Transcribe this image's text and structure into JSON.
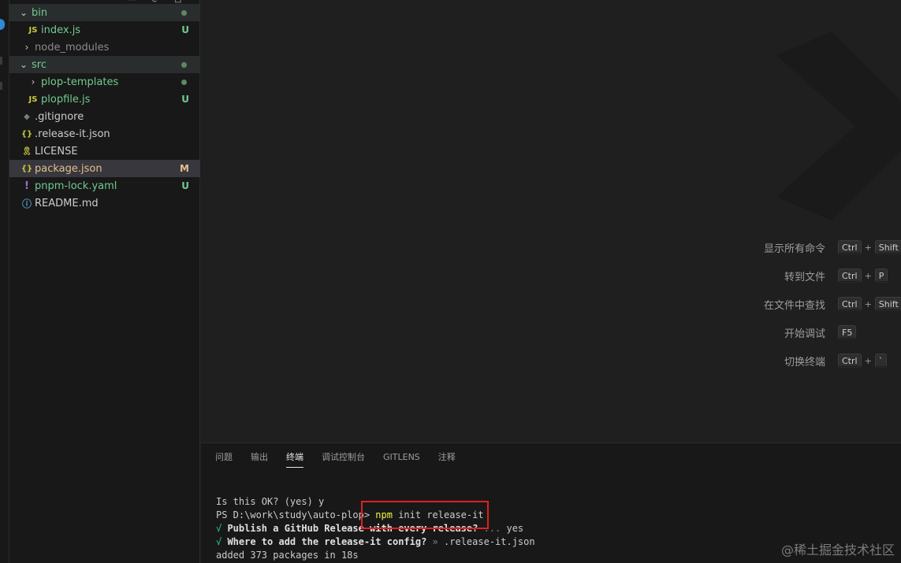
{
  "explorer": {
    "items": [
      {
        "name": "bin",
        "type": "folder",
        "open": true,
        "status": "dot"
      },
      {
        "name": "index.js",
        "type": "js",
        "icon": "JS",
        "status": "U"
      },
      {
        "name": "node_modules",
        "type": "folder",
        "open": false,
        "status": ""
      },
      {
        "name": "src",
        "type": "folder",
        "open": true,
        "status": "dot"
      },
      {
        "name": "plop-templates",
        "type": "folder",
        "open": false,
        "status": "dot"
      },
      {
        "name": "plopfile.js",
        "type": "js",
        "icon": "JS",
        "status": "U"
      },
      {
        "name": ".gitignore",
        "type": "git",
        "icon": "◆",
        "status": ""
      },
      {
        "name": ".release-it.json",
        "type": "json",
        "icon": "{}",
        "status": ""
      },
      {
        "name": "LICENSE",
        "type": "license",
        "icon": "🎗",
        "status": ""
      },
      {
        "name": "package.json",
        "type": "json",
        "icon": "{}",
        "status": "M"
      },
      {
        "name": "pnpm-lock.yaml",
        "type": "yaml",
        "icon": "!",
        "status": "U"
      },
      {
        "name": "README.md",
        "type": "info",
        "icon": "ⓘ",
        "status": ""
      }
    ]
  },
  "shortcuts": [
    {
      "label": "显示所有命令",
      "keys": [
        "Ctrl",
        "Shift"
      ]
    },
    {
      "label": "转到文件",
      "keys": [
        "Ctrl",
        "P"
      ]
    },
    {
      "label": "在文件中查找",
      "keys": [
        "Ctrl",
        "Shift"
      ]
    },
    {
      "label": "开始调试",
      "keys": [
        "F5"
      ]
    },
    {
      "label": "切换终端",
      "keys": [
        "Ctrl",
        "`"
      ]
    }
  ],
  "panel": {
    "tabs": [
      "问题",
      "输出",
      "终端",
      "调试控制台",
      "GITLENS",
      "注释"
    ],
    "active_tab": "终端"
  },
  "terminal": {
    "line1": "Is this OK? (yes) y",
    "prompt": "PS D:\\work\\study\\auto-plop> ",
    "cmd_npm": "npm",
    "cmd_rest": " init release-it",
    "check1_mark": "√",
    "check1_q": " Publish a GitHub Release with every release?",
    "check1_sep": " ... ",
    "check1_a": "yes",
    "check2_mark": "√",
    "check2_q": " Where to add the release-it config?",
    "check2_sep": " » ",
    "check2_a": ".release-it.json",
    "line5": "added 373 packages in 18s"
  },
  "watermark": "@稀土掘金技术社区",
  "colors": {
    "accent": "#2f88d8",
    "untracked": "#73c991",
    "modified": "#e2c08d",
    "highlight_box": "#e02020"
  }
}
